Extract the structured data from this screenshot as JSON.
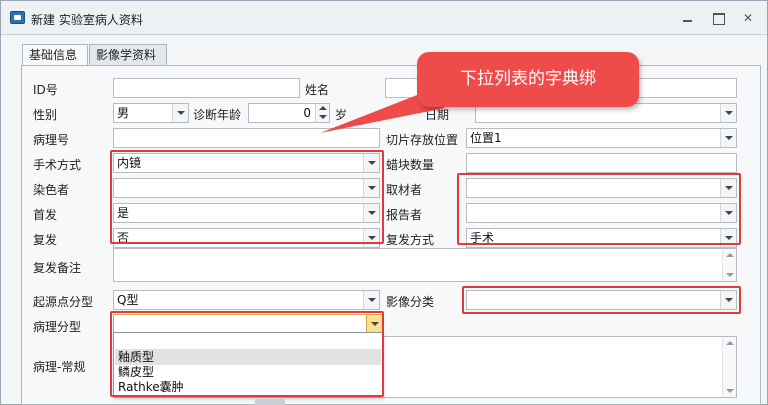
{
  "window": {
    "title": "新建 实验室病人资料"
  },
  "tabs": [
    {
      "label": "基础信息",
      "active": true
    },
    {
      "label": "影像学资料",
      "active": false
    }
  ],
  "form": {
    "id_label": "ID号",
    "id_value": "",
    "name_label": "姓名",
    "name_value": "",
    "date_label": "日期",
    "date_value": "",
    "gender_label": "性别",
    "gender_value": "男",
    "age_label": "诊断年龄",
    "age_value": "0",
    "age_unit": "岁",
    "case_no_label": "病理号",
    "case_no_value": "",
    "slice_loc_label": "切片存放位置",
    "slice_loc_value": "位置1",
    "surgery_label": "手术方式",
    "surgery_value": "内镜",
    "wax_label": "蜡块数量",
    "wax_value": "",
    "stainer_label": "染色者",
    "stainer_value": "",
    "sampler_label": "取材者",
    "sampler_value": "",
    "first_label": "首发",
    "first_value": "是",
    "reporter_label": "报告者",
    "reporter_value": "",
    "recur_label": "复发",
    "recur_value": "否",
    "recur_method_label": "复发方式",
    "recur_method_value": "手术",
    "recur_note_label": "复发备注",
    "recur_note_value": "",
    "origin_label": "起源点分型",
    "origin_value": "Q型",
    "imaging_label": "影像分类",
    "imaging_value": "",
    "path_type_label": "病理分型",
    "path_type_value": "",
    "path_routine_label": "病理-常规",
    "path_routine_value": ""
  },
  "dropdown": {
    "options": [
      "",
      "釉质型",
      "鳞皮型",
      "Rathke囊肿"
    ],
    "highlighted_index": 1
  },
  "annotation": {
    "text": "下拉列表的字典绑",
    "color": "#ef4b4b"
  }
}
